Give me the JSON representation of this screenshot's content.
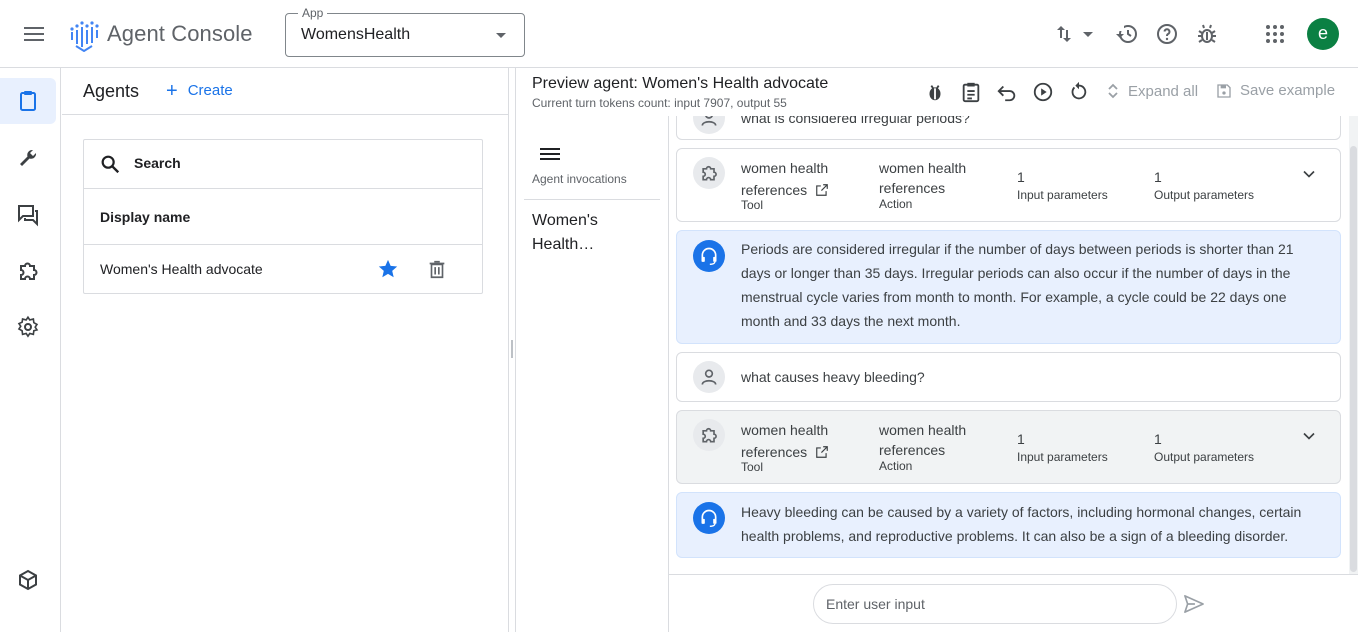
{
  "topbar": {
    "brand": "Agent Console",
    "app_select": {
      "label": "App",
      "value": "WomensHealth"
    },
    "avatar_letter": "e"
  },
  "agents": {
    "title": "Agents",
    "create_label": "Create",
    "search_label": "Search",
    "column_header": "Display name",
    "rows": [
      {
        "name": "Women's Health advocate",
        "starred": true
      }
    ]
  },
  "preview": {
    "title": "Preview agent: Women's Health advocate",
    "tokens": "Current turn tokens count: input 7907, output 55",
    "expand_all": "Expand all",
    "save_example": "Save example"
  },
  "invocations": {
    "label": "Agent invocations",
    "item": "Women's Health…"
  },
  "conversation": {
    "partial_user_msg": "what is considered irregular periods?",
    "tool_calls": [
      {
        "tool": "women health references",
        "tool_label": "Tool",
        "action": "women health references",
        "action_label": "Action",
        "inputs": "1",
        "inputs_label": "Input parameters",
        "outputs": "1",
        "outputs_label": "Output parameters"
      },
      {
        "tool": "women health references",
        "tool_label": "Tool",
        "action": "women health references",
        "action_label": "Action",
        "inputs": "1",
        "inputs_label": "Input parameters",
        "outputs": "1",
        "outputs_label": "Output parameters"
      }
    ],
    "bot_msg_1": "Periods are considered irregular if the number of days between periods is shorter than 21 days or longer than 35 days. Irregular periods can also occur if the number of days in the menstrual cycle varies from month to month. For example, a cycle could be 22 days one month and 33 days the next month.",
    "user_msg_2": "what causes heavy bleeding?",
    "bot_msg_2": "Heavy bleeding can be caused by a variety of factors, including hormonal changes, certain health problems, and reproductive problems. It can also be a sign of a bleeding disorder."
  },
  "input": {
    "placeholder": "Enter user input"
  },
  "colors": {
    "accent": "#1a73e8",
    "bot_bubble": "#e8f0fe",
    "avatar": "#0b8043"
  }
}
